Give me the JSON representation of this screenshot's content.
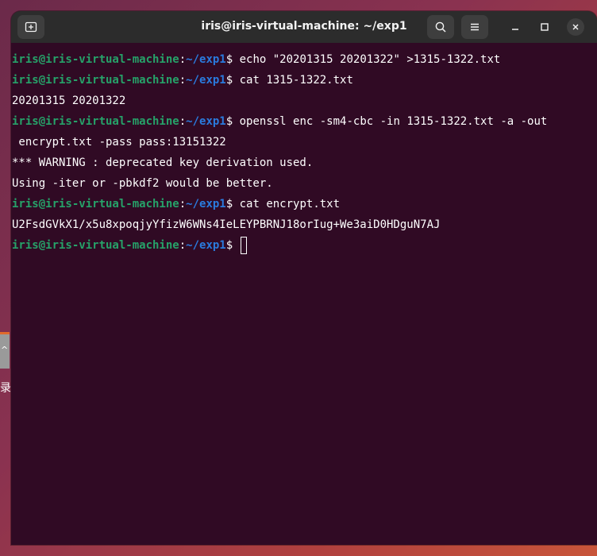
{
  "window": {
    "title": "iris@iris-virtual-machine: ~/exp1"
  },
  "desktop": {
    "tab_glyph": "^",
    "side_char": "录"
  },
  "prompt": {
    "user_host": "iris@iris-virtual-machine",
    "colon": ":",
    "path": "~/exp1",
    "symbol": "$"
  },
  "terminal": {
    "lines": [
      {
        "type": "cmd",
        "text": " echo \"20201315 20201322\" >1315-1322.txt"
      },
      {
        "type": "cmd",
        "text": " cat 1315-1322.txt"
      },
      {
        "type": "out",
        "text": "20201315 20201322"
      },
      {
        "type": "cmd",
        "text": " openssl enc -sm4-cbc -in 1315-1322.txt -a -out"
      },
      {
        "type": "out",
        "text": " encrypt.txt -pass pass:13151322"
      },
      {
        "type": "out",
        "text": "*** WARNING : deprecated key derivation used."
      },
      {
        "type": "out",
        "text": "Using -iter or -pbkdf2 would be better."
      },
      {
        "type": "cmd",
        "text": " cat encrypt.txt"
      },
      {
        "type": "out",
        "text": "U2FsdGVkX1/x5u8xpoqjyYfizW6WNs4IeLEYPBRNJ18orIug+We3aiD0HDguN7AJ"
      },
      {
        "type": "cmd",
        "text": " "
      }
    ]
  },
  "colors": {
    "terminal_bg": "#300a24",
    "titlebar_bg": "#2c2c2c",
    "prompt_user": "#26a269",
    "prompt_path": "#2a7bde"
  }
}
